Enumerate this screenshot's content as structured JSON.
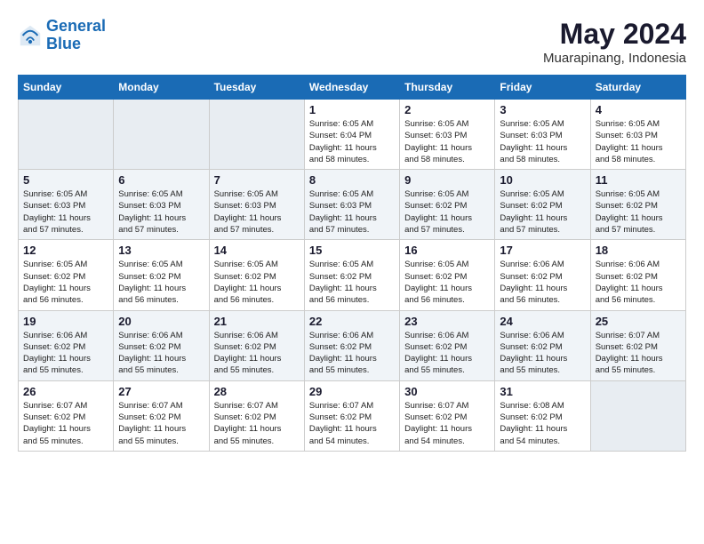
{
  "logo": {
    "text_general": "General",
    "text_blue": "Blue"
  },
  "title": {
    "month_year": "May 2024",
    "location": "Muarapinang, Indonesia"
  },
  "headers": [
    "Sunday",
    "Monday",
    "Tuesday",
    "Wednesday",
    "Thursday",
    "Friday",
    "Saturday"
  ],
  "weeks": [
    [
      {
        "num": "",
        "info": ""
      },
      {
        "num": "",
        "info": ""
      },
      {
        "num": "",
        "info": ""
      },
      {
        "num": "1",
        "info": "Sunrise: 6:05 AM\nSunset: 6:04 PM\nDaylight: 11 hours\nand 58 minutes."
      },
      {
        "num": "2",
        "info": "Sunrise: 6:05 AM\nSunset: 6:03 PM\nDaylight: 11 hours\nand 58 minutes."
      },
      {
        "num": "3",
        "info": "Sunrise: 6:05 AM\nSunset: 6:03 PM\nDaylight: 11 hours\nand 58 minutes."
      },
      {
        "num": "4",
        "info": "Sunrise: 6:05 AM\nSunset: 6:03 PM\nDaylight: 11 hours\nand 58 minutes."
      }
    ],
    [
      {
        "num": "5",
        "info": "Sunrise: 6:05 AM\nSunset: 6:03 PM\nDaylight: 11 hours\nand 57 minutes."
      },
      {
        "num": "6",
        "info": "Sunrise: 6:05 AM\nSunset: 6:03 PM\nDaylight: 11 hours\nand 57 minutes."
      },
      {
        "num": "7",
        "info": "Sunrise: 6:05 AM\nSunset: 6:03 PM\nDaylight: 11 hours\nand 57 minutes."
      },
      {
        "num": "8",
        "info": "Sunrise: 6:05 AM\nSunset: 6:03 PM\nDaylight: 11 hours\nand 57 minutes."
      },
      {
        "num": "9",
        "info": "Sunrise: 6:05 AM\nSunset: 6:02 PM\nDaylight: 11 hours\nand 57 minutes."
      },
      {
        "num": "10",
        "info": "Sunrise: 6:05 AM\nSunset: 6:02 PM\nDaylight: 11 hours\nand 57 minutes."
      },
      {
        "num": "11",
        "info": "Sunrise: 6:05 AM\nSunset: 6:02 PM\nDaylight: 11 hours\nand 57 minutes."
      }
    ],
    [
      {
        "num": "12",
        "info": "Sunrise: 6:05 AM\nSunset: 6:02 PM\nDaylight: 11 hours\nand 56 minutes."
      },
      {
        "num": "13",
        "info": "Sunrise: 6:05 AM\nSunset: 6:02 PM\nDaylight: 11 hours\nand 56 minutes."
      },
      {
        "num": "14",
        "info": "Sunrise: 6:05 AM\nSunset: 6:02 PM\nDaylight: 11 hours\nand 56 minutes."
      },
      {
        "num": "15",
        "info": "Sunrise: 6:05 AM\nSunset: 6:02 PM\nDaylight: 11 hours\nand 56 minutes."
      },
      {
        "num": "16",
        "info": "Sunrise: 6:05 AM\nSunset: 6:02 PM\nDaylight: 11 hours\nand 56 minutes."
      },
      {
        "num": "17",
        "info": "Sunrise: 6:06 AM\nSunset: 6:02 PM\nDaylight: 11 hours\nand 56 minutes."
      },
      {
        "num": "18",
        "info": "Sunrise: 6:06 AM\nSunset: 6:02 PM\nDaylight: 11 hours\nand 56 minutes."
      }
    ],
    [
      {
        "num": "19",
        "info": "Sunrise: 6:06 AM\nSunset: 6:02 PM\nDaylight: 11 hours\nand 55 minutes."
      },
      {
        "num": "20",
        "info": "Sunrise: 6:06 AM\nSunset: 6:02 PM\nDaylight: 11 hours\nand 55 minutes."
      },
      {
        "num": "21",
        "info": "Sunrise: 6:06 AM\nSunset: 6:02 PM\nDaylight: 11 hours\nand 55 minutes."
      },
      {
        "num": "22",
        "info": "Sunrise: 6:06 AM\nSunset: 6:02 PM\nDaylight: 11 hours\nand 55 minutes."
      },
      {
        "num": "23",
        "info": "Sunrise: 6:06 AM\nSunset: 6:02 PM\nDaylight: 11 hours\nand 55 minutes."
      },
      {
        "num": "24",
        "info": "Sunrise: 6:06 AM\nSunset: 6:02 PM\nDaylight: 11 hours\nand 55 minutes."
      },
      {
        "num": "25",
        "info": "Sunrise: 6:07 AM\nSunset: 6:02 PM\nDaylight: 11 hours\nand 55 minutes."
      }
    ],
    [
      {
        "num": "26",
        "info": "Sunrise: 6:07 AM\nSunset: 6:02 PM\nDaylight: 11 hours\nand 55 minutes."
      },
      {
        "num": "27",
        "info": "Sunrise: 6:07 AM\nSunset: 6:02 PM\nDaylight: 11 hours\nand 55 minutes."
      },
      {
        "num": "28",
        "info": "Sunrise: 6:07 AM\nSunset: 6:02 PM\nDaylight: 11 hours\nand 55 minutes."
      },
      {
        "num": "29",
        "info": "Sunrise: 6:07 AM\nSunset: 6:02 PM\nDaylight: 11 hours\nand 54 minutes."
      },
      {
        "num": "30",
        "info": "Sunrise: 6:07 AM\nSunset: 6:02 PM\nDaylight: 11 hours\nand 54 minutes."
      },
      {
        "num": "31",
        "info": "Sunrise: 6:08 AM\nSunset: 6:02 PM\nDaylight: 11 hours\nand 54 minutes."
      },
      {
        "num": "",
        "info": ""
      }
    ]
  ]
}
